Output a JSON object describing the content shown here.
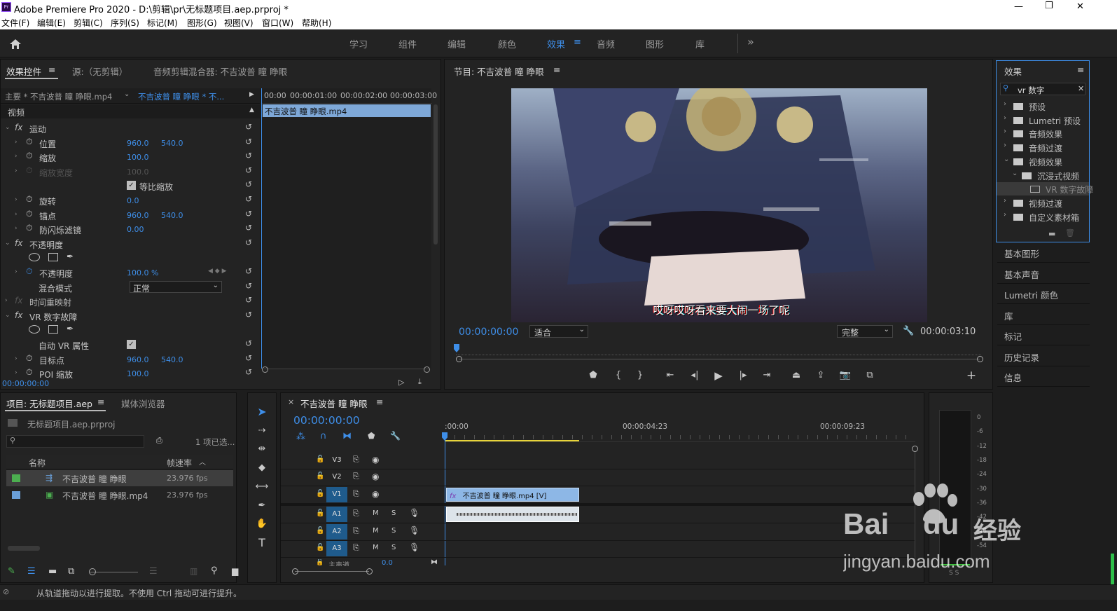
{
  "app": {
    "title": "Adobe Premiere Pro 2020 - D:\\剪辑\\pr\\无标题项目.aep.prproj *",
    "icon_text": "Pr",
    "win_min": "—",
    "win_max": "❐",
    "win_close": "✕"
  },
  "menu": [
    "文件(F)",
    "编辑(E)",
    "剪辑(C)",
    "序列(S)",
    "标记(M)",
    "图形(G)",
    "视图(V)",
    "窗口(W)",
    "帮助(H)"
  ],
  "workspaces": [
    "学习",
    "组件",
    "编辑",
    "颜色",
    "效果",
    "音频",
    "图形",
    "库"
  ],
  "ws_more": "»",
  "effect_controls": {
    "tabs": [
      "效果控件",
      "源:（无剪辑）",
      "音频剪辑混合器: 不吉波普 瞳 睁眼"
    ],
    "menu_glyph": "≡",
    "master": "主要 * 不吉波普 瞳 睁眼.mp4",
    "sequence": "不吉波普 瞳 睁眼 * 不...",
    "ruler": [
      "00:00",
      "00:00:01:00",
      "00:00:02:00",
      "00:00:03:00"
    ],
    "clip_bar": "不吉波普 瞳 睁眼.mp4",
    "section": "视频",
    "rows": [
      {
        "fx": "fx",
        "name": "运动",
        "v1": "",
        "v2": ""
      },
      {
        "name": "位置",
        "v1": "960.0",
        "v2": "540.0"
      },
      {
        "name": "缩放",
        "v1": "100.0",
        "v2": ""
      },
      {
        "name": "缩放宽度",
        "v1": "100.0",
        "v2": ""
      },
      {
        "name": "等比缩放",
        "v1": "",
        "v2": ""
      },
      {
        "name": "旋转",
        "v1": "0.0",
        "v2": ""
      },
      {
        "name": "锚点",
        "v1": "960.0",
        "v2": "540.0"
      },
      {
        "name": "防闪烁滤镜",
        "v1": "0.00",
        "v2": ""
      },
      {
        "fx": "fx",
        "name": "不透明度",
        "v1": "",
        "v2": ""
      },
      {
        "name": "",
        "v1": "",
        "v2": ""
      },
      {
        "name": "不透明度",
        "v1": "100.0 %",
        "v2": ""
      },
      {
        "name": "混合模式",
        "v1": "正常",
        "v2": ""
      },
      {
        "fx": "fx",
        "name": "时间重映射",
        "v1": "",
        "v2": ""
      },
      {
        "fx": "fx",
        "name": "VR 数字故障",
        "v1": "",
        "v2": ""
      },
      {
        "name": "",
        "v1": "",
        "v2": ""
      },
      {
        "name": "自动 VR 属性",
        "v1": "",
        "v2": ""
      },
      {
        "name": "目标点",
        "v1": "960.0",
        "v2": "540.0"
      },
      {
        "name": "POI 缩放",
        "v1": "100.0",
        "v2": ""
      }
    ],
    "reset_glyph": "↺",
    "timecode": "00:00:00:00"
  },
  "program": {
    "title": "节目: 不吉波普 瞳 睁眼",
    "subtitle": "哎呀哎呀看来要大闹一场了呢",
    "timecode": "00:00:00:00",
    "fit": "适合",
    "quality": "完整",
    "duration": "00:00:03:10",
    "add": "+"
  },
  "effects": {
    "title": "效果",
    "search": "vr 数字",
    "tree": [
      {
        "label": "预设",
        "level": 0,
        "open": false
      },
      {
        "label": "Lumetri 预设",
        "level": 0,
        "open": false
      },
      {
        "label": "音频效果",
        "level": 0,
        "open": false
      },
      {
        "label": "音频过渡",
        "level": 0,
        "open": false
      },
      {
        "label": "视频效果",
        "level": 0,
        "open": true
      },
      {
        "label": "沉浸式视频",
        "level": 1,
        "open": true
      },
      {
        "label": "VR 数字故障",
        "level": 2,
        "open": false
      },
      {
        "label": "视频过渡",
        "level": 0,
        "open": false
      },
      {
        "label": "自定义素材箱",
        "level": 0,
        "open": false
      }
    ],
    "panels": [
      "基本图形",
      "基本声音",
      "Lumetri 颜色",
      "库",
      "标记",
      "历史记录",
      "信息"
    ]
  },
  "project": {
    "tabs": [
      "项目: 无标题项目.aep",
      "媒体浏览器"
    ],
    "file": "无标题项目.aep.prproj",
    "selected": "1 项已选...",
    "cols": [
      "名称",
      "帧速率"
    ],
    "items": [
      {
        "name": "不吉波普 瞳 睁眼",
        "fps": "23.976 fps",
        "color": "#4caf50"
      },
      {
        "name": "不吉波普 瞳 睁眼.mp4",
        "fps": "23.976 fps",
        "color": "#6a9fd8"
      }
    ]
  },
  "timeline": {
    "close": "×",
    "title": "不吉波普 瞳 睁眼",
    "timecode": "00:00:00:00",
    "ruler": [
      ":00:00",
      "00:00:04:23",
      "00:00:09:23"
    ],
    "video_tracks": [
      "V3",
      "V2",
      "V1"
    ],
    "audio_tracks": [
      "A1",
      "A2",
      "A3"
    ],
    "master": "主声道",
    "master_val": "0.0",
    "clip_v": "不吉波普 瞳 睁眼.mp4 [V]",
    "m": "M",
    "s": "S"
  },
  "meter": {
    "labels": [
      "0",
      "-6",
      "-12",
      "-18",
      "-24",
      "-30",
      "-36",
      "-42",
      "-48",
      "-54"
    ],
    "footer": "S S"
  },
  "status": "从轨道拖动以进行提取。不使用 Ctrl 拖动可进行提升。",
  "watermark": {
    "main": "Bai",
    "du": "du",
    "jingyan": "经验",
    "url": "jingyan.baidu.com"
  }
}
